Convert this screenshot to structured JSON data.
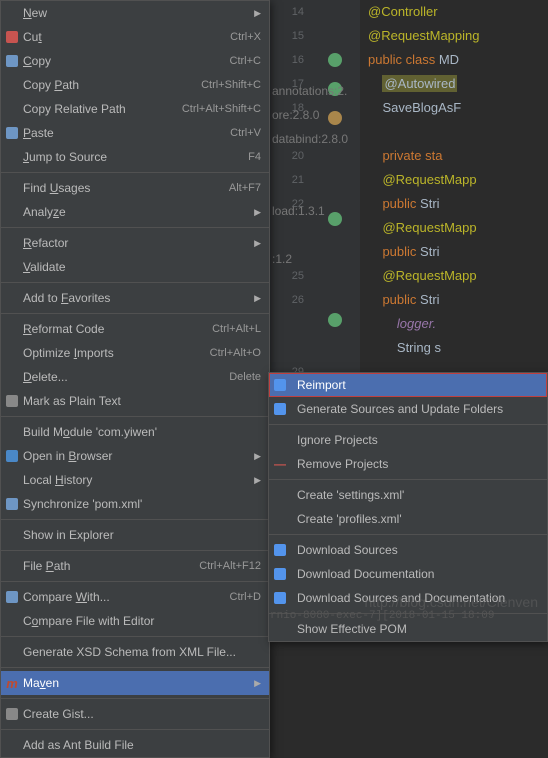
{
  "gutter_start": 14,
  "gutter_end": 32,
  "code": [
    {
      "segs": [
        {
          "t": "@Controller",
          "c": "an"
        }
      ]
    },
    {
      "segs": [
        {
          "t": "@RequestMapping",
          "c": "an"
        }
      ]
    },
    {
      "segs": [
        {
          "t": "public class ",
          "c": "kw"
        },
        {
          "t": "MD",
          "c": "ty"
        }
      ]
    },
    {
      "segs": [
        {
          "t": "    ",
          "c": ""
        },
        {
          "t": "@Autowired",
          "c": "hl"
        }
      ]
    },
    {
      "segs": [
        {
          "t": "    SaveBlogAsF",
          "c": "ty"
        }
      ]
    },
    {
      "segs": [
        {
          "t": "",
          "c": ""
        }
      ]
    },
    {
      "segs": [
        {
          "t": "    ",
          "c": ""
        },
        {
          "t": "private sta",
          "c": "kw"
        }
      ]
    },
    {
      "segs": [
        {
          "t": "    ",
          "c": ""
        },
        {
          "t": "@RequestMapp",
          "c": "an"
        }
      ]
    },
    {
      "segs": [
        {
          "t": "    ",
          "c": ""
        },
        {
          "t": "public ",
          "c": "kw"
        },
        {
          "t": "Stri",
          "c": "ty"
        }
      ]
    },
    {
      "segs": [
        {
          "t": "    ",
          "c": ""
        },
        {
          "t": "@RequestMapp",
          "c": "an"
        }
      ]
    },
    {
      "segs": [
        {
          "t": "    ",
          "c": ""
        },
        {
          "t": "public ",
          "c": "kw"
        },
        {
          "t": "Stri",
          "c": "ty"
        }
      ]
    },
    {
      "segs": [
        {
          "t": "    ",
          "c": ""
        },
        {
          "t": "@RequestMapp",
          "c": "an"
        }
      ]
    },
    {
      "segs": [
        {
          "t": "    ",
          "c": ""
        },
        {
          "t": "public ",
          "c": "kw"
        },
        {
          "t": "Stri",
          "c": "ty"
        }
      ]
    },
    {
      "segs": [
        {
          "t": "        ",
          "c": ""
        },
        {
          "t": "logger.",
          "c": "fn"
        }
      ]
    },
    {
      "segs": [
        {
          "t": "        String s",
          "c": "ty"
        }
      ]
    }
  ],
  "bg_annotations": [
    "annotations:2.",
    "ore:2.8.0",
    "databind:2.8.0",
    "",
    "",
    "load:1.3.1",
    "",
    ":1.2"
  ],
  "menu": [
    {
      "label": "New",
      "u": 0,
      "arrow": true
    },
    {
      "label": "Cut",
      "u": 2,
      "sc": "Ctrl+X",
      "icon": "cut"
    },
    {
      "label": "Copy",
      "u": 0,
      "sc": "Ctrl+C",
      "icon": "copy"
    },
    {
      "label": "Copy Path",
      "u": 5,
      "sc": "Ctrl+Shift+C"
    },
    {
      "label": "Copy Relative Path",
      "sc": "Ctrl+Alt+Shift+C"
    },
    {
      "label": "Paste",
      "u": 0,
      "sc": "Ctrl+V",
      "icon": "paste"
    },
    {
      "label": "Jump to Source",
      "u": 0,
      "sc": "F4"
    },
    {
      "sep": true
    },
    {
      "label": "Find Usages",
      "u": 5,
      "sc": "Alt+F7"
    },
    {
      "label": "Analyze",
      "u": 5,
      "arrow": true
    },
    {
      "sep": true
    },
    {
      "label": "Refactor",
      "u": 0,
      "arrow": true
    },
    {
      "label": "Validate",
      "u": 0
    },
    {
      "sep": true
    },
    {
      "label": "Add to Favorites",
      "u": 7,
      "arrow": true
    },
    {
      "sep": true
    },
    {
      "label": "Reformat Code",
      "u": 0,
      "sc": "Ctrl+Alt+L"
    },
    {
      "label": "Optimize Imports",
      "u": 9,
      "sc": "Ctrl+Alt+O"
    },
    {
      "label": "Delete...",
      "u": 0,
      "sc": "Delete"
    },
    {
      "label": "Mark as Plain Text",
      "icon": "text"
    },
    {
      "sep": true
    },
    {
      "label": "Build Module 'com.yiwen'",
      "u": 7
    },
    {
      "label": "Open in Browser",
      "u": 8,
      "arrow": true,
      "icon": "globe"
    },
    {
      "label": "Local History",
      "u": 6,
      "arrow": true
    },
    {
      "label": "Synchronize 'pom.xml'",
      "icon": "sync"
    },
    {
      "sep": true
    },
    {
      "label": "Show in Explorer"
    },
    {
      "sep": true
    },
    {
      "label": "File Path",
      "u": 5,
      "sc": "Ctrl+Alt+F12"
    },
    {
      "sep": true
    },
    {
      "label": "Compare With...",
      "u": 8,
      "sc": "Ctrl+D",
      "icon": "compare"
    },
    {
      "label": "Compare File with Editor",
      "u": 1
    },
    {
      "sep": true
    },
    {
      "label": "Generate XSD Schema from XML File..."
    },
    {
      "sep": true
    },
    {
      "label": "Maven",
      "u": 2,
      "arrow": true,
      "icon": "maven",
      "hover": true
    },
    {
      "sep": true
    },
    {
      "label": "Create Gist...",
      "icon": "gist"
    },
    {
      "sep": true
    },
    {
      "label": "Add as Ant Build File"
    }
  ],
  "submenu": [
    {
      "label": "Reimport",
      "icon": "reimport",
      "hover": true
    },
    {
      "label": "Generate Sources and Update Folders",
      "icon": "generate"
    },
    {
      "sep": true
    },
    {
      "label": "Ignore Projects"
    },
    {
      "label": "Remove Projects",
      "icon": "remove"
    },
    {
      "sep": true
    },
    {
      "label": "Create 'settings.xml'"
    },
    {
      "label": "Create 'profiles.xml'"
    },
    {
      "sep": true
    },
    {
      "label": "Download Sources",
      "icon": "download"
    },
    {
      "label": "Download Documentation",
      "icon": "download"
    },
    {
      "label": "Download Sources and Documentation",
      "icon": "download"
    },
    {
      "sep": true
    },
    {
      "label": "Show Effective POM"
    }
  ],
  "footer": "rnio-8080-exec-7][2018-01-15 18:09",
  "watermark": "http://blog.csdn.net/Cienven"
}
